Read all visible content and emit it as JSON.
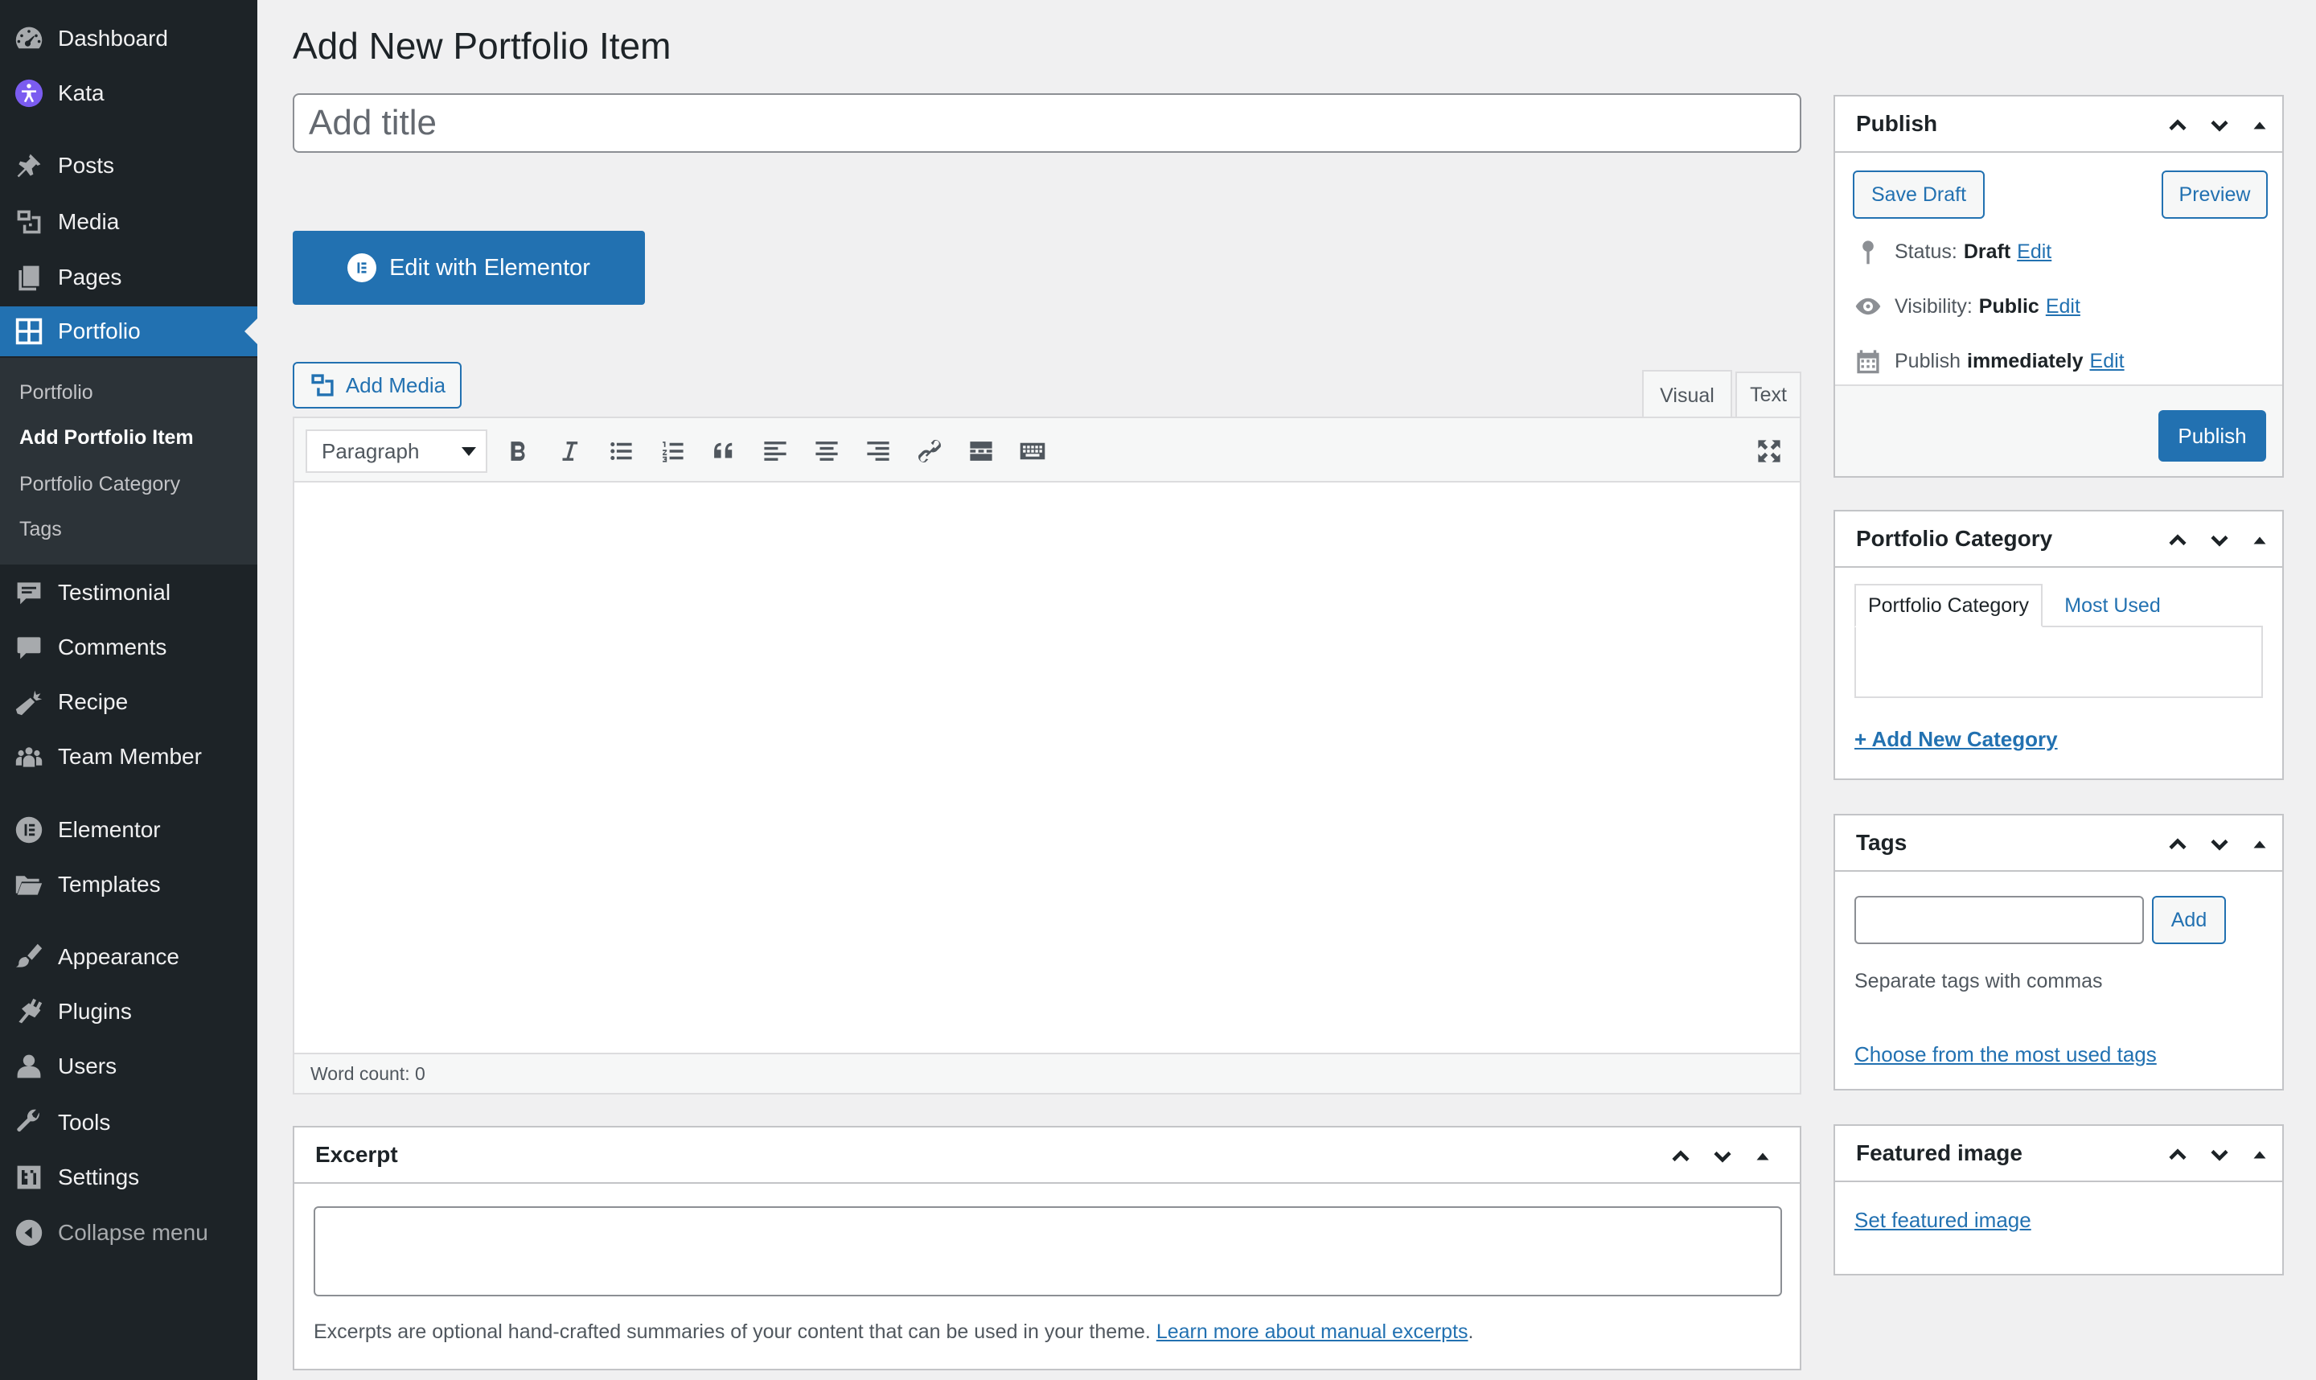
{
  "sidebar": {
    "items": [
      {
        "label": "Dashboard",
        "icon": "dashboard-icon"
      },
      {
        "label": "Kata",
        "icon": "kata-icon"
      },
      {
        "label": "Posts",
        "icon": "pin-icon"
      },
      {
        "label": "Media",
        "icon": "media-icon"
      },
      {
        "label": "Pages",
        "icon": "pages-icon"
      },
      {
        "label": "Portfolio",
        "icon": "portfolio-icon",
        "active": true
      },
      {
        "label": "Testimonial",
        "icon": "testimonial-icon"
      },
      {
        "label": "Comments",
        "icon": "comments-icon"
      },
      {
        "label": "Recipe",
        "icon": "carrot-icon"
      },
      {
        "label": "Team Member",
        "icon": "groups-icon"
      },
      {
        "label": "Elementor",
        "icon": "elementor-icon"
      },
      {
        "label": "Templates",
        "icon": "folder-icon"
      },
      {
        "label": "Appearance",
        "icon": "brush-icon"
      },
      {
        "label": "Plugins",
        "icon": "plugin-icon"
      },
      {
        "label": "Users",
        "icon": "user-icon"
      },
      {
        "label": "Tools",
        "icon": "wrench-icon"
      },
      {
        "label": "Settings",
        "icon": "settings-icon"
      }
    ],
    "submenu": [
      {
        "label": "Portfolio"
      },
      {
        "label": "Add Portfolio Item",
        "current": true
      },
      {
        "label": "Portfolio Category"
      },
      {
        "label": "Tags"
      }
    ],
    "collapse_label": "Collapse menu"
  },
  "main": {
    "page_title": "Add New Portfolio Item",
    "title_placeholder": "Add title",
    "elementor_button": "Edit with Elementor",
    "add_media": "Add Media",
    "tabs": {
      "visual": "Visual",
      "text": "Text"
    },
    "format_select": "Paragraph",
    "word_count": "Word count: 0"
  },
  "excerpt": {
    "title": "Excerpt",
    "note": "Excerpts are optional hand-crafted summaries of your content that can be used in your theme.",
    "link": "Learn more about manual excerpts",
    "period": "."
  },
  "publish": {
    "title": "Publish",
    "save_draft": "Save Draft",
    "preview": "Preview",
    "status_label": "Status:",
    "status_value": "Draft",
    "visibility_label": "Visibility:",
    "visibility_value": "Public",
    "publish_label": "Publish",
    "publish_value": "immediately",
    "edit": "Edit",
    "publish_button": "Publish"
  },
  "portfolio_category": {
    "title": "Portfolio Category",
    "tab_all": "Portfolio Category",
    "tab_most_used": "Most Used",
    "add_new": "+ Add New Category"
  },
  "tags": {
    "title": "Tags",
    "add_button": "Add",
    "note": "Separate tags with commas",
    "choose_link": "Choose from the most used tags"
  },
  "featured_image": {
    "title": "Featured image",
    "set_link": "Set featured image"
  },
  "colors": {
    "accent": "#2271b1",
    "sidebar_bg": "#1d2327",
    "submenu_bg": "#2c3338",
    "page_bg": "#f0f0f1"
  }
}
